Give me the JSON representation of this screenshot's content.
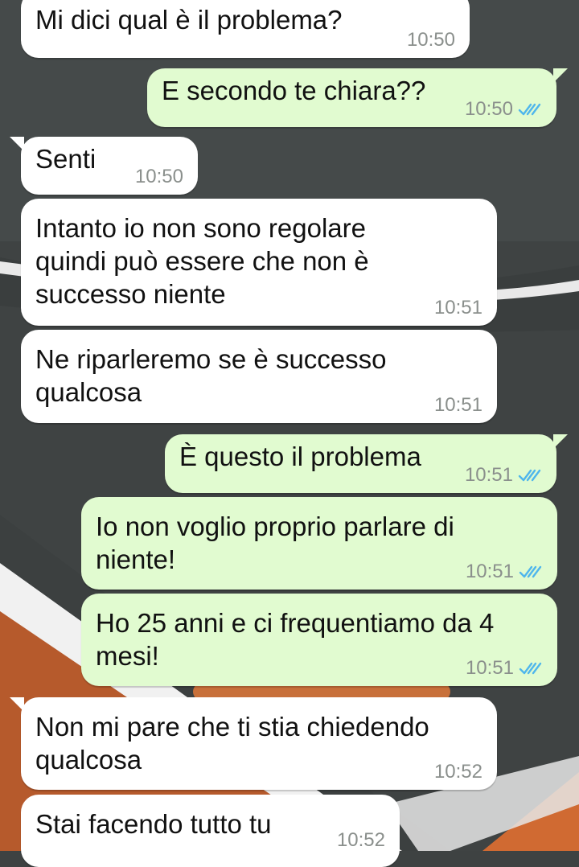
{
  "messages": [
    {
      "direction": "incoming",
      "text": "Mi dici qual è il problema?",
      "time": "10:50"
    },
    {
      "direction": "outgoing",
      "text": "E secondo te chiara??",
      "time": "10:50",
      "status": "read-ticks-icon"
    },
    {
      "direction": "incoming",
      "text": "Senti",
      "time": "10:50"
    },
    {
      "direction": "incoming",
      "text": "Intanto io non sono regolare\nquindi può essere che non è\nsuccesso niente",
      "time": "10:51"
    },
    {
      "direction": "incoming",
      "text": "Ne riparleremo se è successo\nqualcosa",
      "time": "10:51"
    },
    {
      "direction": "outgoing",
      "text": "È questo il problema",
      "time": "10:51",
      "status": "read-ticks-icon"
    },
    {
      "direction": "outgoing",
      "text": "Io non voglio proprio parlare di\nniente!",
      "time": "10:51",
      "status": "read-ticks-icon"
    },
    {
      "direction": "outgoing",
      "text": "Ho 25 anni e ci frequentiamo da 4\nmesi!",
      "time": "10:51",
      "status": "read-ticks-icon"
    },
    {
      "direction": "incoming",
      "text": "Non mi pare che ti stia chiedendo\nqualcosa",
      "time": "10:52"
    },
    {
      "direction": "incoming",
      "text": "Stai facendo tutto tu",
      "time": "10:52"
    }
  ],
  "colors": {
    "incoming_bubble": "#ffffff",
    "outgoing_bubble": "#e1fbd0",
    "read_ticks": "#4fb6ec",
    "timestamp": "#8a8f8c",
    "wallpaper_dark": "#3e4242",
    "wallpaper_orange": "#b65a2c"
  }
}
